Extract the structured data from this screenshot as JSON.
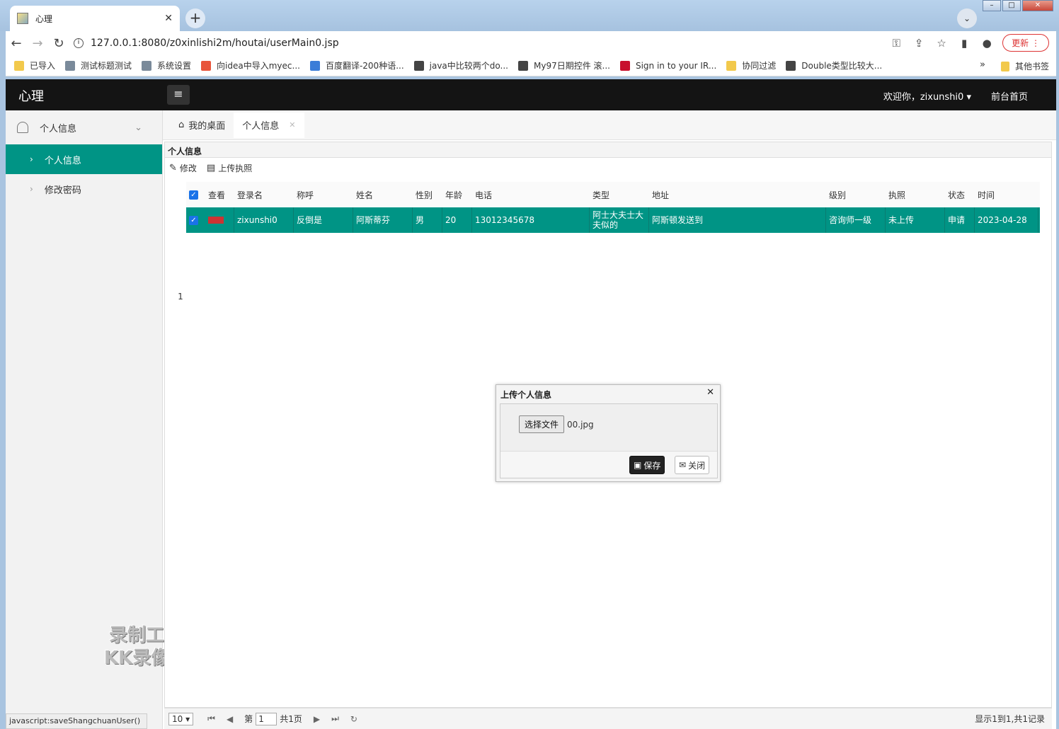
{
  "browser": {
    "tab_title": "心理",
    "url": "127.0.0.1:8080/z0xinlishi2m/houtai/userMain0.jsp",
    "update_label": "更新",
    "bookmarks": [
      {
        "label": "已导入",
        "color": "#f2c94c"
      },
      {
        "label": "测试标题测试",
        "color": "#7a8a9a"
      },
      {
        "label": "系统设置",
        "color": "#7a8a9a"
      },
      {
        "label": "向idea中导入myec...",
        "color": "#e8543a"
      },
      {
        "label": "百度翻译-200种语...",
        "color": "#3b7dd8"
      },
      {
        "label": "java中比较两个do...",
        "color": "#444444"
      },
      {
        "label": "My97日期控件 滚...",
        "color": "#444444"
      },
      {
        "label": "Sign in to your IR...",
        "color": "#c8102e"
      },
      {
        "label": "协同过滤",
        "color": "#f2c94c"
      },
      {
        "label": "Double类型比较大...",
        "color": "#444444"
      }
    ],
    "bookmarks_more": "»",
    "other_bookmarks": "其他书签"
  },
  "app": {
    "logo": "心理",
    "welcome": "欢迎你，zixunshi0",
    "front_page": "前台首页"
  },
  "sidebar": {
    "group_label": "个人信息",
    "items": [
      {
        "label": "个人信息",
        "active": true
      },
      {
        "label": "修改密码",
        "active": false
      }
    ]
  },
  "page_tabs": [
    {
      "label": "我的桌面"
    },
    {
      "label": "个人信息"
    }
  ],
  "panel": {
    "title": "个人信息",
    "toolbar": {
      "edit": "修改",
      "upload": "上传执照"
    }
  },
  "grid": {
    "columns": [
      "查看",
      "登录名",
      "称呼",
      "姓名",
      "性别",
      "年龄",
      "电话",
      "类型",
      "地址",
      "级别",
      "执照",
      "状态",
      "时间"
    ],
    "rows": [
      {
        "num": "1",
        "cells": [
          "",
          "zixunshi0",
          "反倒是",
          "阿斯蒂芬",
          "男",
          "20",
          "13012345678",
          "阿士大夫士大夫似的",
          "阿斯顿发送到",
          "咨询师一级",
          "未上传",
          "申请",
          "2023-04-28"
        ]
      }
    ]
  },
  "pager": {
    "page_size": "10",
    "page_prefix": "第",
    "page_value": "1",
    "page_total": "共1页",
    "summary": "显示1到1,共1记录"
  },
  "dialog": {
    "title": "上传个人信息",
    "choose_file": "选择文件",
    "file_name": "00.jpg",
    "save": "保存",
    "close": "关闭"
  },
  "status_bar": "javascript:saveShangchuanUser()",
  "watermark": {
    "line1": "录制工具",
    "line2": "KK录像机"
  },
  "colors": {
    "accent": "#009485",
    "topbar": "#141414"
  }
}
